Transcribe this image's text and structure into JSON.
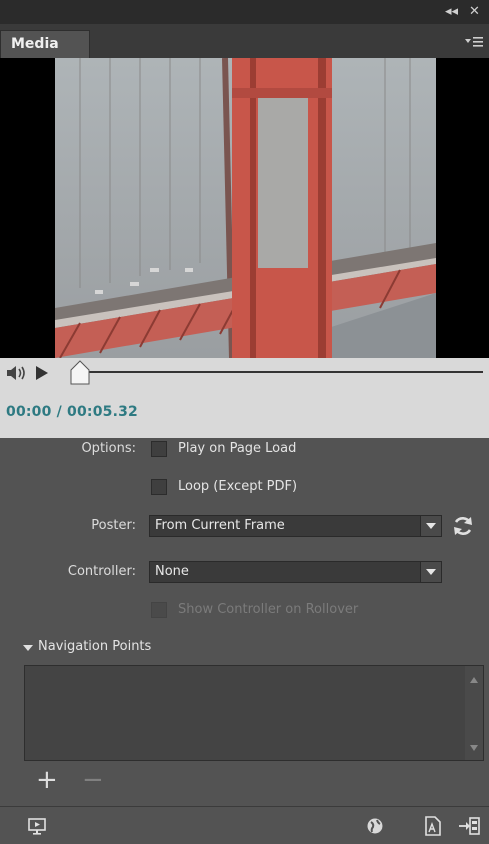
{
  "panel": {
    "tab_label": "Media",
    "collapse_glyph": "◂◂",
    "close_glyph": "✕"
  },
  "transport": {
    "time": "00:00 / 00:05.32",
    "progress": 0
  },
  "options": {
    "label": "Options:",
    "play_on_load": {
      "label": "Play on Page Load",
      "checked": false
    },
    "loop": {
      "label": "Loop (Except PDF)",
      "checked": false
    }
  },
  "poster": {
    "label": "Poster:",
    "value": "From Current Frame"
  },
  "controller": {
    "label": "Controller:",
    "value": "None",
    "show_on_rollover": {
      "label": "Show Controller on Rollover",
      "checked": false,
      "enabled": false
    }
  },
  "navigation_points": {
    "header": "Navigation Points",
    "items": [],
    "add_glyph": "+",
    "remove_glyph": "−"
  },
  "bottom_toolbar": {
    "icons": [
      "preview-icon",
      "globe-icon",
      "pdf-export-icon",
      "insert-media-icon"
    ]
  },
  "colors": {
    "panel_bg": "#535353",
    "time_text": "#2e7a82",
    "transport_bg": "#d9d9d9"
  }
}
